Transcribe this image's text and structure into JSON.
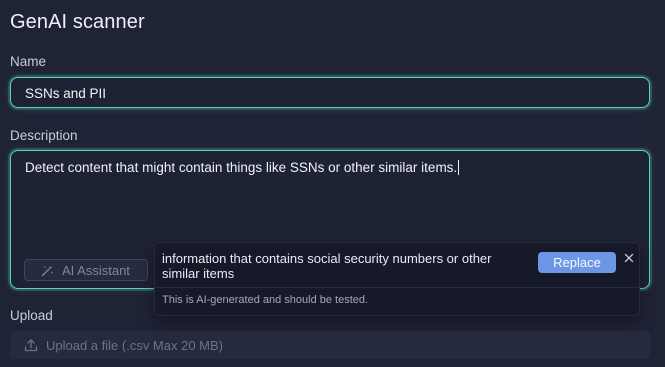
{
  "page": {
    "title": "GenAI scanner"
  },
  "name_field": {
    "label": "Name",
    "value": "SSNs and PII"
  },
  "description_field": {
    "label": "Description",
    "value": "Detect content that might contain things like SSNs or other similar items."
  },
  "ai_assistant": {
    "label": "AI Assistant",
    "icon": "magic-wand-icon"
  },
  "suggestion_popover": {
    "text": "information that contains social security numbers or other similar items",
    "replace_label": "Replace",
    "close_icon": "close-icon",
    "note": "This is AI-generated and should be tested."
  },
  "upload": {
    "label": "Upload",
    "button_label": "Upload a file (.csv Max 20 MB)",
    "icon": "upload-icon"
  },
  "colors": {
    "background": "#1f2336",
    "focus_border": "#5fd2ba",
    "replace_button": "#6e96e6",
    "popover_background": "#15192a"
  }
}
